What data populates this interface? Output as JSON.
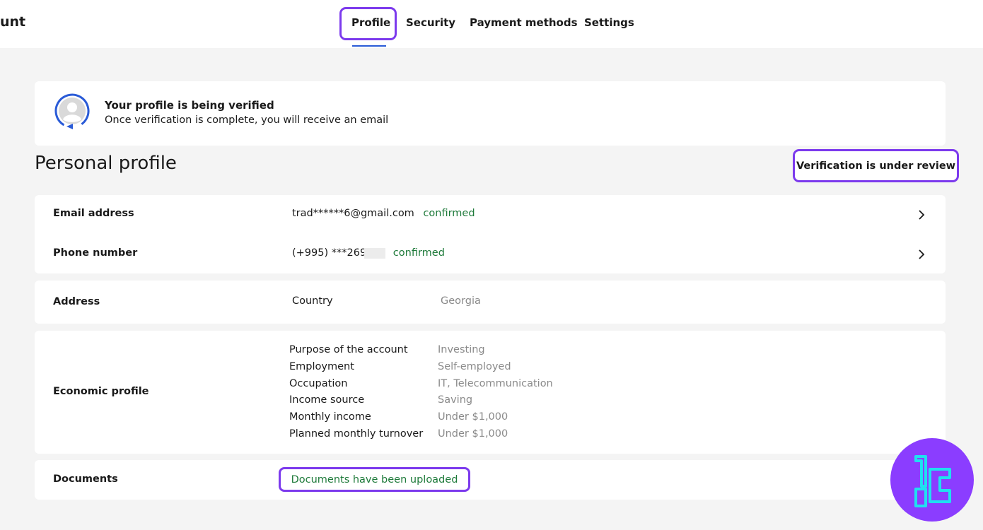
{
  "header": {
    "brand_fragment": "unt",
    "tabs": [
      {
        "label": "Profile",
        "active": true
      },
      {
        "label": "Security",
        "active": false
      },
      {
        "label": "Payment methods",
        "active": false
      },
      {
        "label": "Settings",
        "active": false
      }
    ]
  },
  "banner": {
    "title": "Your profile is being verified",
    "subtitle": "Once verification is complete, you will receive an email"
  },
  "profile": {
    "title": "Personal profile",
    "status_badge": "Verification is under review",
    "email": {
      "label": "Email address",
      "value": "trad******6@gmail.com",
      "status": "confirmed"
    },
    "phone": {
      "label": "Phone number",
      "value": "(+995) ***269",
      "status": "confirmed"
    },
    "address": {
      "label": "Address",
      "field": "Country",
      "value": "Georgia"
    },
    "economic": {
      "label": "Economic profile",
      "items": [
        {
          "key": "Purpose of the account",
          "value": "Investing"
        },
        {
          "key": "Employment",
          "value": "Self-employed"
        },
        {
          "key": "Occupation",
          "value": "IT, Telecommunication"
        },
        {
          "key": "Income source",
          "value": "Saving"
        },
        {
          "key": "Monthly income",
          "value": "Under $1,000"
        },
        {
          "key": "Planned monthly turnover",
          "value": "Under $1,000"
        }
      ]
    },
    "documents": {
      "label": "Documents",
      "status": "Documents have been uploaded"
    }
  },
  "colors": {
    "accent_highlight": "#7c3aed",
    "confirmed": "#1e7a3a",
    "tab_underline": "#2a5bd7",
    "logo_bg": "#8b3dff",
    "logo_mark": "#1fe0f0"
  },
  "icons": {
    "avatar": "user-avatar-icon",
    "chevron": "chevron-right-icon",
    "logo": "brand-logo-icon"
  }
}
